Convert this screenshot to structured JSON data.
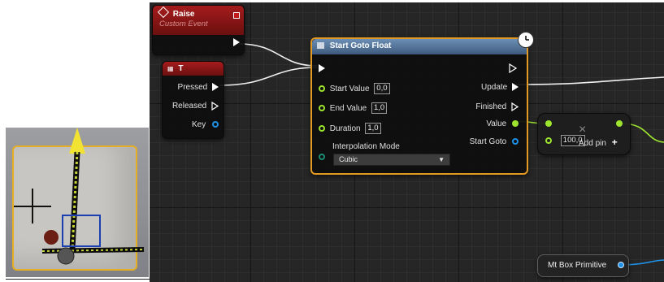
{
  "raise_node": {
    "title": "Raise",
    "subtitle": "Custom Event"
  },
  "t_node": {
    "title": "T",
    "pins": {
      "pressed": "Pressed",
      "released": "Released",
      "key": "Key"
    }
  },
  "goto_node": {
    "title": "Start Goto Float",
    "inputs": {
      "start_value_label": "Start Value",
      "start_value": "0,0",
      "end_value_label": "End Value",
      "end_value": "1,0",
      "duration_label": "Duration",
      "duration": "1,0",
      "interp_label": "Interpolation Mode",
      "interp_value": "Cubic"
    },
    "outputs": {
      "update": "Update",
      "finished": "Finished",
      "value": "Value",
      "start_goto": "Start Goto"
    }
  },
  "add_node": {
    "value": "100,0",
    "add_pin": "Add pin",
    "add_symbol": "+",
    "op_symbol": "×"
  },
  "mt_node": {
    "label": "Mt Box Primitive"
  },
  "colors": {
    "event_red": "#a51c1c",
    "function_blue": "#4a6d94",
    "selection_orange": "#e39a22",
    "float_pin": "#9ee52f",
    "struct_pin": "#1e90e6",
    "exec_pin": "#ffffff"
  },
  "icons": {
    "raise": "event-diamond-icon",
    "t": "keyboard-icon",
    "goto": "function-icon",
    "clock": "clock-icon",
    "delegate": "delegate-square-icon"
  }
}
